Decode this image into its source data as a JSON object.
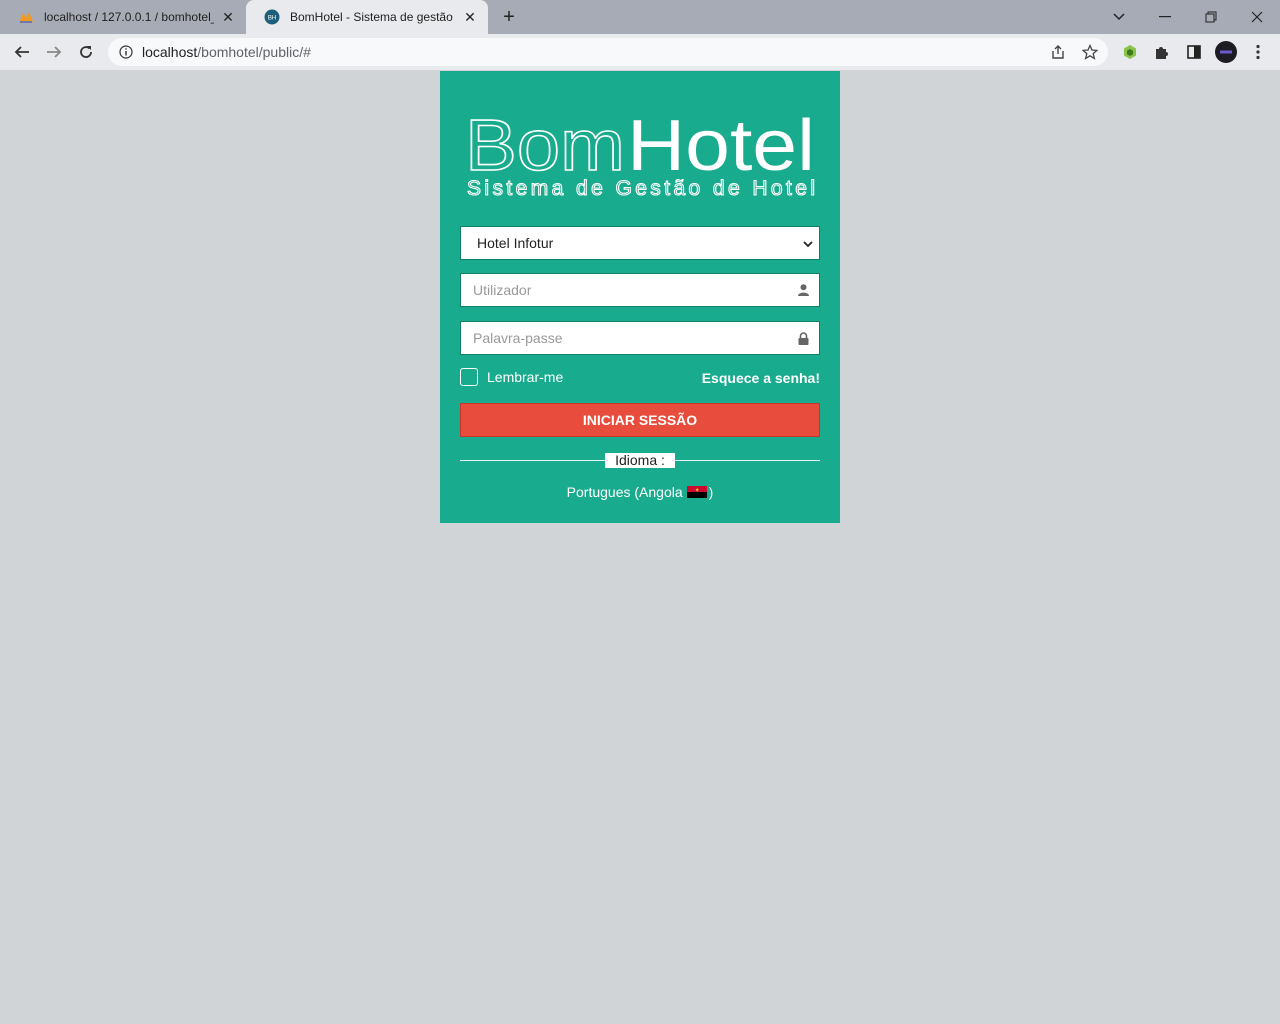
{
  "browser": {
    "tabs": [
      {
        "title": "localhost / 127.0.0.1 / bomhotel_",
        "active": false,
        "icon": "phpmyadmin-icon"
      },
      {
        "title": "BomHotel - Sistema de gestão de",
        "active": true,
        "icon": "bomhotel-favicon"
      }
    ],
    "url_host": "localhost",
    "url_path": "/bomhotel/public/#"
  },
  "login": {
    "logo_word_light": "Bom",
    "logo_word_bold": "Hotel",
    "logo_tagline": "Sistema de Gestão de Hotel",
    "hotel_selected": "Hotel Infotur",
    "username_placeholder": "Utilizador",
    "password_placeholder": "Palavra-passe",
    "remember_label": "Lembrar-me",
    "forgot_label": "Esquece a senha!",
    "submit_label": "INICIAR SESSÃO",
    "language_heading": "Idioma :",
    "language_prefix": "Portugues (Angola",
    "language_suffix": ")"
  },
  "colors": {
    "card_bg": "#19ab8d",
    "button_bg": "#e74c3c",
    "page_bg": "#d1d4d7"
  }
}
